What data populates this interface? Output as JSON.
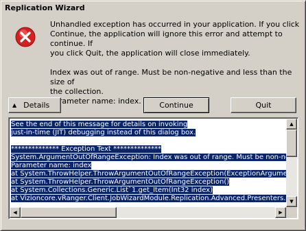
{
  "window": {
    "title": "Replication Wizard"
  },
  "icon": {
    "name": "error-icon",
    "color": "#d42020"
  },
  "message": {
    "line1": "Unhandled exception has occurred in your application. If you click",
    "line2": "Continue, the application will ignore this error and attempt to continue. If",
    "line3": "you click Quit, the application will close immediately.",
    "line4": "Index was out of range. Must be non-negative and less than the size of",
    "line5": "the collection.",
    "line6": "Parameter name: index."
  },
  "buttons": {
    "details": "Details",
    "details_arrow": "▲",
    "continue": "Continue",
    "quit": "Quit"
  },
  "details": {
    "lines": [
      "See the end of this message for details on invoking",
      "just-in-time (JIT) debugging instead of this dialog box.",
      "",
      "************** Exception Text **************",
      "System.ArgumentOutOfRangeException: Index was out of range. Must be non-negative and less than the size of the collection.",
      "Parameter name: index",
      "   at System.ThrowHelper.ThrowArgumentOutOfRangeException(ExceptionArgument argument, ExceptionResource resource)",
      "   at System.ThrowHelper.ThrowArgumentOutOfRangeException()",
      "   at System.Collections.Generic.List`1.get_Item(Int32 index)",
      "   at Vizioncore.vRanger.Client.JobWizardModule.Replication.Advanced.Presenters.ReplicationPresenter"
    ],
    "selection_color": "#0a246a"
  }
}
